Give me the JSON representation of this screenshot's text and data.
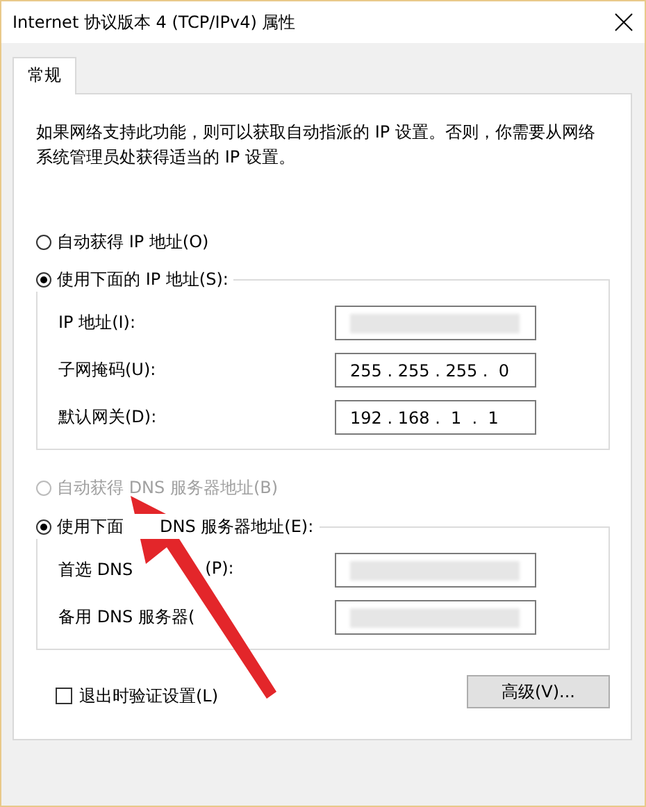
{
  "window": {
    "title": "Internet 协议版本 4 (TCP/IPv4) 属性"
  },
  "tabs": [
    {
      "label": "常规",
      "selected": true
    }
  ],
  "description": "如果网络支持此功能，则可以获取自动指派的 IP 设置。否则，你需要从网络系统管理员处获得适当的 IP 设置。",
  "ip_section": {
    "options": [
      {
        "label": "自动获得 IP 地址(O)",
        "selected": false,
        "disabled": false
      },
      {
        "label": "使用下面的 IP 地址(S):",
        "selected": true,
        "disabled": false
      }
    ],
    "fields": [
      {
        "label_parts": [
          "IP 地址(I):"
        ],
        "redacted": true
      },
      {
        "label_parts": [
          "子网掩码(U):"
        ],
        "value": "255 . 255 . 255 .  0",
        "redacted": false
      },
      {
        "label_parts": [
          "默认网关(D):"
        ],
        "value": "192 . 168 .  1  .  1",
        "redacted": false
      }
    ]
  },
  "dns_section": {
    "options": [
      {
        "label_parts": [
          "自动获得 DNS 服务器地址(B)"
        ],
        "selected": false,
        "disabled": true
      },
      {
        "label_parts": [
          "使用下面",
          "DNS 服务器地址(E):"
        ],
        "selected": true,
        "disabled": false
      }
    ],
    "fields": [
      {
        "label_parts": [
          "首选 DNS",
          "(P):"
        ],
        "redacted": true
      },
      {
        "label_parts": [
          "备用 DNS 服务器("
        ],
        "redacted": true
      }
    ]
  },
  "validate_on_exit": {
    "label": "退出时验证设置(L)",
    "checked": false
  },
  "advanced_button": "高级(V)...",
  "annotation": {
    "kind": "arrow"
  }
}
